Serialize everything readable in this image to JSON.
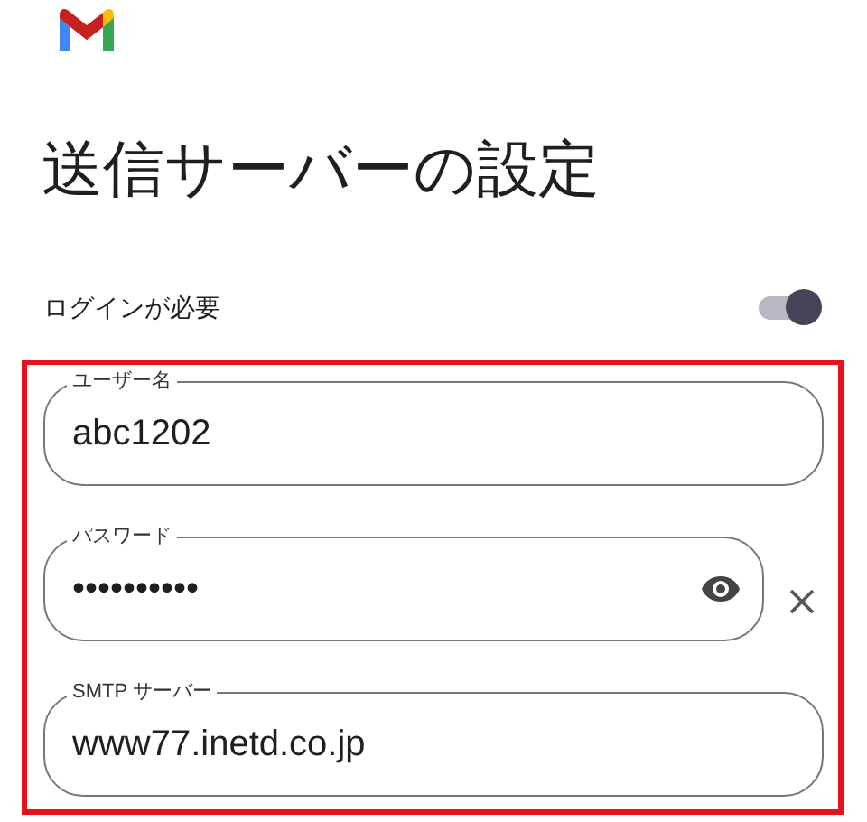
{
  "title": "送信サーバーの設定",
  "login_required": {
    "label": "ログインが必要",
    "on": true
  },
  "fields": [
    {
      "kind": "text",
      "label": "ユーザー名",
      "value": "abc1202"
    },
    {
      "kind": "password",
      "label": "パスワード",
      "value": "••••••••••"
    },
    {
      "kind": "text",
      "label": "SMTP サーバー",
      "value": "www77.inetd.co.jp"
    }
  ]
}
